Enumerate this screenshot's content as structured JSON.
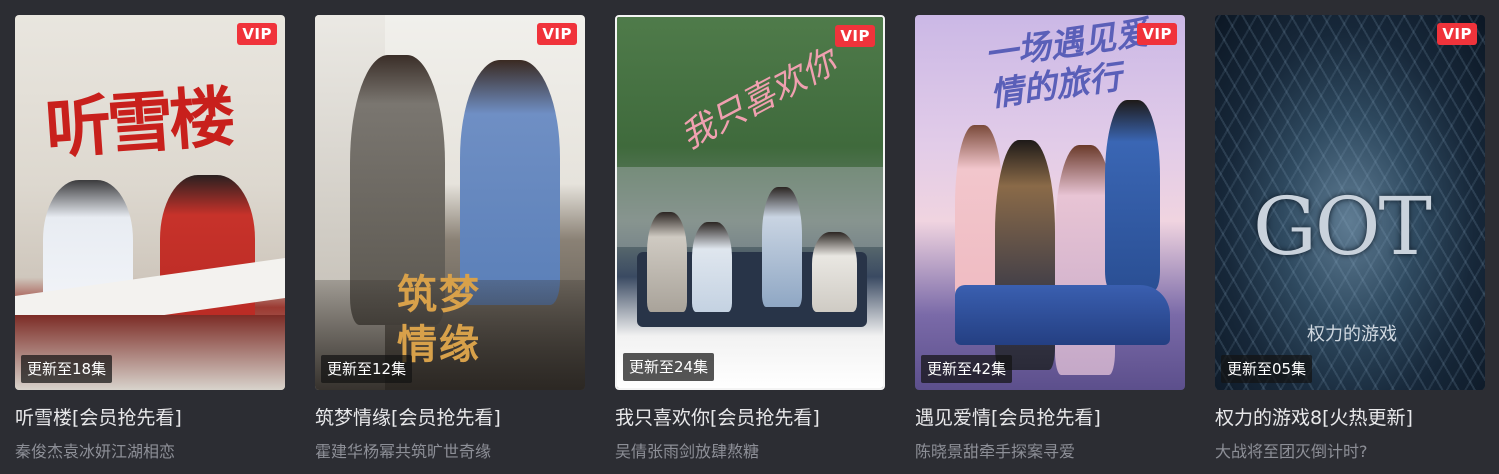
{
  "cards": [
    {
      "poster_title": "听雪楼",
      "vip": "VIP",
      "episode": "更新至18集",
      "title": "听雪楼[会员抢先看]",
      "subtitle": "秦俊杰袁冰妍江湖相恋"
    },
    {
      "poster_title": "筑梦情缘",
      "vip": "VIP",
      "episode": "更新至12集",
      "title": "筑梦情缘[会员抢先看]",
      "subtitle": "霍建华杨幂共筑旷世奇缘"
    },
    {
      "poster_title": "我只喜欢你",
      "vip": "VIP",
      "episode": "更新至24集",
      "title": "我只喜欢你[会员抢先看]",
      "subtitle": "吴倩张雨剑放肆熬糖"
    },
    {
      "poster_title": "一场遇见爱情的旅行",
      "vip": "VIP",
      "episode": "更新至42集",
      "title": "遇见爱情[会员抢先看]",
      "subtitle": "陈晓景甜牵手探案寻爱"
    },
    {
      "poster_title": "GOT",
      "poster_subtitle": "权力的游戏",
      "vip": "VIP",
      "episode": "更新至05集",
      "title": "权力的游戏8[火热更新]",
      "subtitle": "大战将至团灭倒计时?"
    }
  ],
  "colors": {
    "background": "#2c2d33",
    "vip_badge": "#f0333b",
    "title_text": "#e8e8ea",
    "subtitle_text": "#8d8f97"
  }
}
